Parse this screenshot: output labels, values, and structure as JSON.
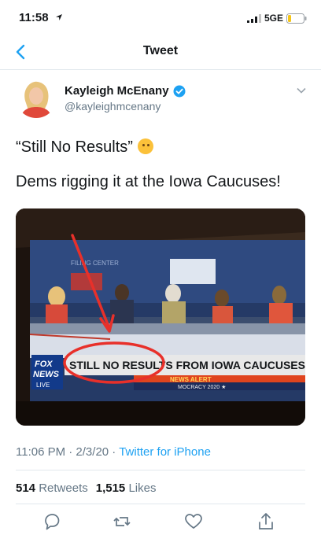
{
  "status_bar": {
    "time": "11:58",
    "network": "5GE"
  },
  "nav": {
    "title": "Tweet",
    "back_icon": "chevron-left-icon"
  },
  "tweet": {
    "author_name": "Kayleigh McEnany",
    "author_handle": "@kayleighmcenany",
    "verified": true,
    "text_line1": "“Still No Results”",
    "text_line2": "Dems rigging it at the Iowa Caucuses!",
    "emoji": "thinking-face-icon",
    "media": {
      "banner_text": "STILL NO RESULTS FROM IOWA CAUCUSES",
      "logo_line1": "FOX",
      "logo_line2": "NEWS",
      "logo_line3": "LIVE",
      "alert_text": "NEWS ALERT",
      "bottom_text": "MOCRACY 2020 ★",
      "screen_title": "FILING CENTER"
    },
    "timestamp": "11:06 PM · 2/3/20 · ",
    "source": "Twitter for iPhone",
    "retweets_count": "514",
    "retweets_label": "Retweets",
    "likes_count": "1,515",
    "likes_label": "Likes"
  },
  "colors": {
    "accent": "#1da1f2",
    "muted": "#657786",
    "border": "#e1e8ed",
    "circle": "#e8302a"
  }
}
